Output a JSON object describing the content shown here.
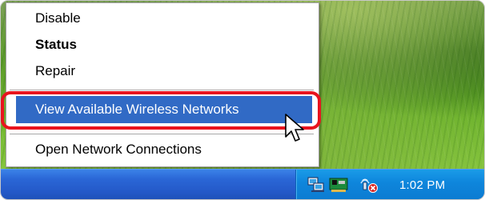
{
  "desktop": {
    "background": "green-grass-wallpaper"
  },
  "context_menu": {
    "items": [
      {
        "label": "Disable",
        "bold": false
      },
      {
        "label": "Status",
        "bold": true
      },
      {
        "label": "Repair",
        "bold": false
      },
      {
        "label": "View Available Wireless Networks",
        "bold": false,
        "highlighted": true
      },
      {
        "label": "Open Network Connections",
        "bold": false
      }
    ],
    "highlight_color": "#316ac5",
    "annotation_color": "#e8141e"
  },
  "taskbar": {
    "color": "#2459c8",
    "tray": {
      "icons": [
        "network-connection-icon",
        "network-card-icon",
        "wireless-network-icon"
      ],
      "clock": "1:02 PM"
    }
  },
  "cursor": {
    "icon": "arrow-cursor-icon"
  }
}
